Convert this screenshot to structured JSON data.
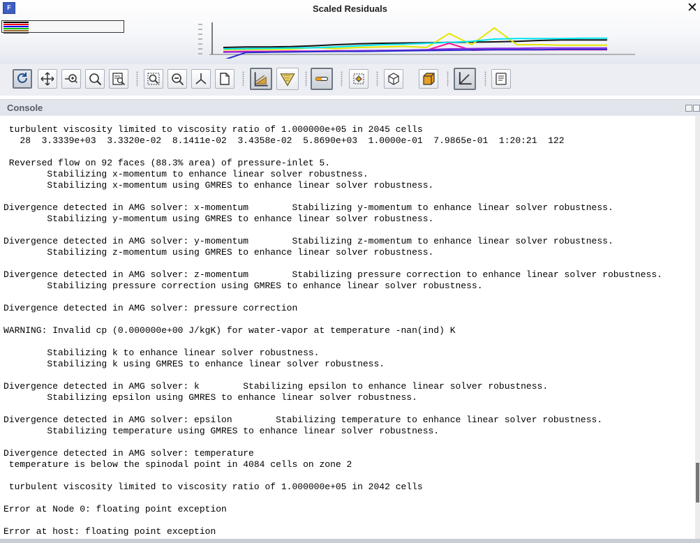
{
  "window": {
    "title": "Scaled Residuals",
    "app_icon": "F",
    "close_glyph": "✕"
  },
  "residual_plot": {
    "legend_colors": [
      "#000000",
      "#ff0000",
      "#0000ff",
      "#00c000",
      "#9a6a2a",
      "#333333"
    ],
    "series": [
      {
        "color": "#111111",
        "values": [
          0.2,
          0.22,
          0.22,
          0.23,
          0.26,
          0.3,
          0.33,
          0.35,
          0.36,
          0.37,
          0.38,
          0.39,
          0.4,
          0.42,
          0.45,
          0.47,
          0.47,
          0.47
        ]
      },
      {
        "color": "#e6e600",
        "values": [
          0.12,
          0.13,
          0.13,
          0.14,
          0.2,
          0.16,
          0.2,
          0.22,
          0.24,
          0.2,
          0.7,
          0.3,
          0.9,
          0.3,
          0.3,
          0.28,
          0.28,
          0.28
        ]
      },
      {
        "color": "#00e5ee",
        "values": [
          0.15,
          0.16,
          0.17,
          0.18,
          0.19,
          0.22,
          0.26,
          0.3,
          0.32,
          0.35,
          0.38,
          0.42,
          0.5,
          0.52,
          0.52,
          0.52,
          0.53,
          0.53
        ]
      },
      {
        "color": "#ff1493",
        "values": [
          0.05,
          0.06,
          0.06,
          0.07,
          0.07,
          0.08,
          0.08,
          0.09,
          0.09,
          0.1,
          0.35,
          0.1,
          0.12,
          0.12,
          0.12,
          0.12,
          0.12,
          0.12
        ]
      },
      {
        "color": "#8a2be2",
        "values": [
          0.03,
          0.04,
          0.04,
          0.05,
          0.06,
          0.07,
          0.08,
          0.09,
          0.1,
          0.12,
          0.15,
          0.16,
          0.17,
          0.17,
          0.18,
          0.18,
          0.18,
          0.18
        ]
      },
      {
        "color": "#2a2acc",
        "values": [
          -0.25,
          0.02,
          0.03,
          0.04,
          0.05,
          0.06,
          0.06,
          0.07,
          0.08,
          0.09,
          0.1,
          0.11,
          0.12,
          0.12,
          0.12,
          0.13,
          0.13,
          0.13
        ]
      }
    ]
  },
  "toolbar": {
    "buttons": [
      {
        "name": "refresh-icon",
        "active": true
      },
      {
        "name": "pan-icon",
        "active": false
      },
      {
        "name": "zoom-in-out-icon",
        "active": false
      },
      {
        "name": "zoom-icon",
        "active": false
      },
      {
        "name": "zoom-to-box-icon",
        "active": false
      },
      {
        "name": "zoom-fit-icon",
        "active": false
      },
      {
        "name": "zoom-out-icon",
        "active": false
      },
      {
        "name": "axes-icon",
        "active": false
      },
      {
        "name": "page-icon",
        "active": false
      },
      {
        "name": "mesh-display-icon",
        "active": true
      },
      {
        "name": "clip-icon",
        "active": false
      },
      {
        "name": "light-icon",
        "active": true
      },
      {
        "name": "render-settings-icon",
        "active": false
      },
      {
        "name": "cube-icon",
        "active": false
      },
      {
        "name": "view-box-icon",
        "active": false
      },
      {
        "name": "coordinate-axes-icon",
        "active": true
      },
      {
        "name": "report-icon",
        "active": false
      }
    ]
  },
  "console": {
    "title": "Console",
    "lines": [
      " turbulent viscosity limited to viscosity ratio of 1.000000e+05 in 2045 cells",
      "   28  3.3339e+03  3.3320e-02  8.1411e-02  3.4358e-02  5.8690e+03  1.0000e-01  7.9865e-01  1:20:21  122",
      "",
      " Reversed flow on 92 faces (88.3% area) of pressure-inlet 5.",
      "        Stabilizing x-momentum to enhance linear solver robustness.",
      "        Stabilizing x-momentum using GMRES to enhance linear solver robustness.",
      "",
      "Divergence detected in AMG solver: x-momentum        Stabilizing y-momentum to enhance linear solver robustness.",
      "        Stabilizing y-momentum using GMRES to enhance linear solver robustness.",
      "",
      "Divergence detected in AMG solver: y-momentum        Stabilizing z-momentum to enhance linear solver robustness.",
      "        Stabilizing z-momentum using GMRES to enhance linear solver robustness.",
      "",
      "Divergence detected in AMG solver: z-momentum        Stabilizing pressure correction to enhance linear solver robustness.",
      "        Stabilizing pressure correction using GMRES to enhance linear solver robustness.",
      "",
      "Divergence detected in AMG solver: pressure correction",
      "",
      "WARNING: Invalid cp (0.000000e+00 J/kgK) for water-vapor at temperature -nan(ind) K",
      "",
      "        Stabilizing k to enhance linear solver robustness.",
      "        Stabilizing k using GMRES to enhance linear solver robustness.",
      "",
      "Divergence detected in AMG solver: k        Stabilizing epsilon to enhance linear solver robustness.",
      "        Stabilizing epsilon using GMRES to enhance linear solver robustness.",
      "",
      "Divergence detected in AMG solver: epsilon        Stabilizing temperature to enhance linear solver robustness.",
      "        Stabilizing temperature using GMRES to enhance linear solver robustness.",
      "",
      "Divergence detected in AMG solver: temperature",
      " temperature is below the spinodal point in 4084 cells on zone 2",
      "",
      " turbulent viscosity limited to viscosity ratio of 1.000000e+05 in 2042 cells",
      "",
      "Error at Node 0: floating point exception",
      "",
      "Error at host: floating point exception"
    ]
  }
}
